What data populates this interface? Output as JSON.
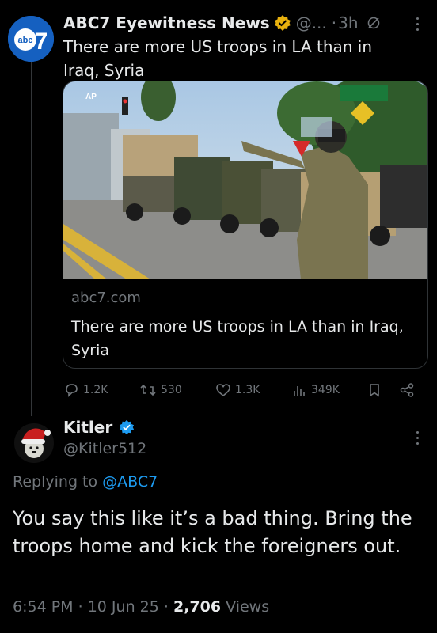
{
  "tweet": {
    "author_name": "ABC7 Eyewitness News",
    "handle_truncated": "@...",
    "separator": "·",
    "time": "3h",
    "text": "There are more US troops in LA than in Iraq, Syria",
    "avatar_text": "abc",
    "avatar_number": "7"
  },
  "card": {
    "image_watermark": "AP",
    "domain": "abc7.com",
    "title": "There are more US troops in LA than in Iraq, Syria"
  },
  "actions": {
    "replies": "1.2K",
    "retweets": "530",
    "likes": "1.3K",
    "views": "349K"
  },
  "reply": {
    "name": "Kitler",
    "handle": "@Kitler512",
    "replying_label": "Replying to",
    "replying_to": "@ABC7",
    "text": "You say this like it’s a bad thing. Bring the troops home and kick the foreigners out.",
    "time": "6:54 PM",
    "date": "10 Jun 25",
    "views_count": "2,706",
    "views_label": "Views",
    "separator": "·"
  },
  "colors": {
    "background": "#000000",
    "text": "#e7e9ea",
    "muted": "#71767b",
    "link": "#1d9bf0",
    "verified_gold": "#e8b10e",
    "verified_blue": "#1d9bf0",
    "abc_blue": "#1560c0"
  },
  "icons": [
    "reply-icon",
    "retweet-icon",
    "like-icon",
    "views-icon",
    "bookmark-icon",
    "share-icon",
    "more-icon",
    "verified-badge-icon",
    "mute-icon"
  ]
}
